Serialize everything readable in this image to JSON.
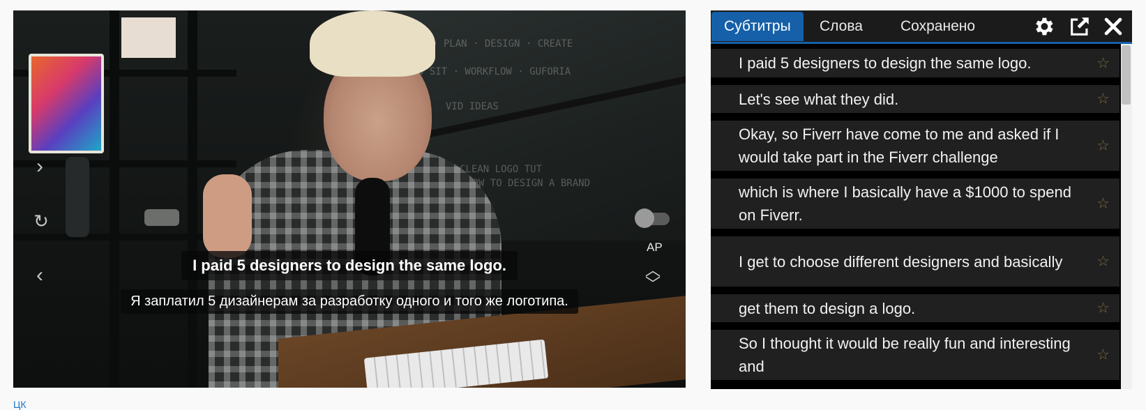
{
  "video": {
    "subtitle_original": "I paid 5 designers to design the same logo.",
    "subtitle_translation": "Я заплатил 5 дизайнерам за разработку одного и того же логотипа.",
    "autopause_label": "AP",
    "autopause_enabled": false,
    "icons": {
      "next": "chevron-right-icon",
      "replay": "replay-icon",
      "prev": "chevron-left-icon",
      "up": "chevron-up-icon",
      "down": "chevron-down-icon"
    }
  },
  "panel": {
    "tabs": [
      {
        "label": "Субтитры",
        "active": true
      },
      {
        "label": "Слова",
        "active": false
      },
      {
        "label": "Сохранено",
        "active": false
      }
    ],
    "tools": [
      "gear-icon",
      "export-icon",
      "close-icon"
    ],
    "accent_color": "#1560a8",
    "star_color": "#7b6c3f",
    "subtitles": [
      {
        "text": "I paid 5 designers to design the same logo."
      },
      {
        "text": "Let's see what they did."
      },
      {
        "text": "Okay, so Fiverr have come to me and asked if I would take part in the Fiverr challenge"
      },
      {
        "text": "which is where I basically have a $1000 to spend on Fiverr."
      },
      {
        "text": "I get to choose different designers and basically"
      },
      {
        "text": "get them to design a logo."
      },
      {
        "text": "So I thought it would be really fun and interesting and"
      }
    ]
  },
  "footer": {
    "link_text": "ЦК"
  }
}
